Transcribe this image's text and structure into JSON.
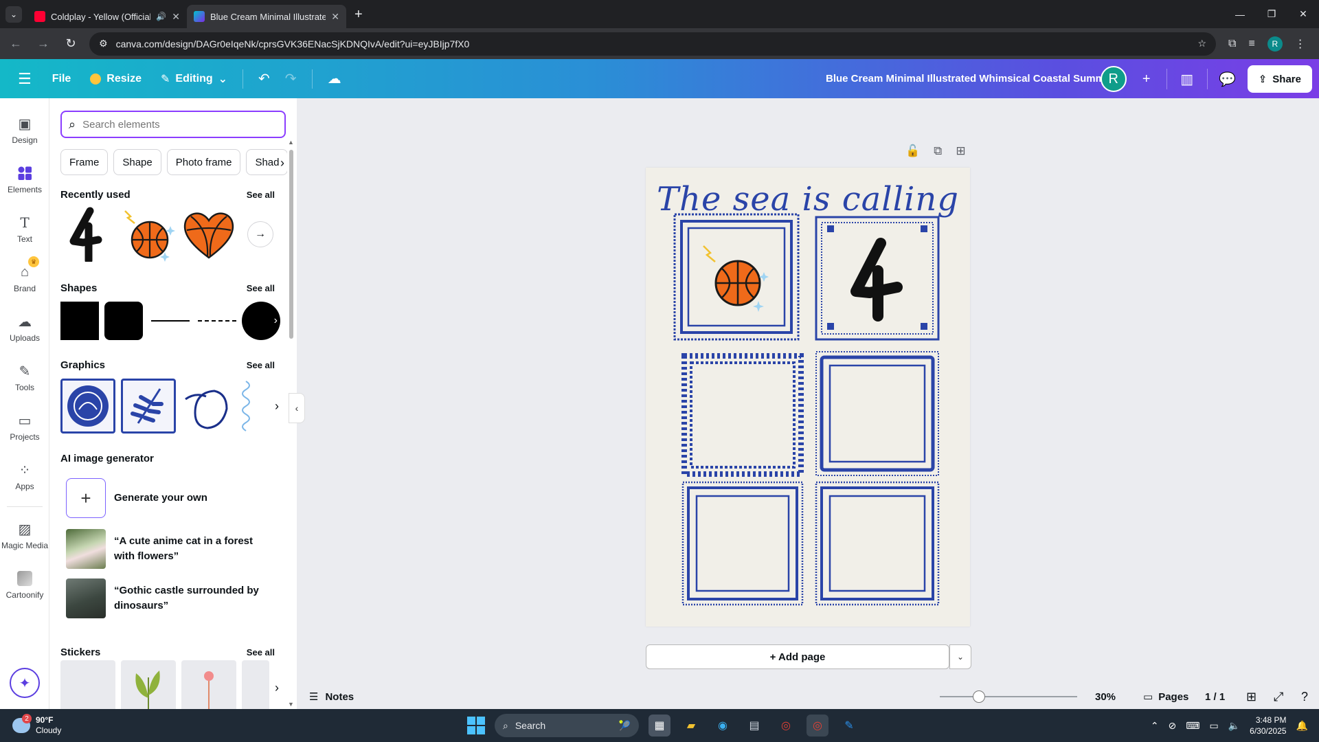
{
  "browser": {
    "tabs": [
      {
        "title": "Coldplay - Yellow (Official V",
        "active": false
      },
      {
        "title": "Blue Cream Minimal Illustrated",
        "active": true
      }
    ],
    "url": "canva.com/design/DAGr0eIqeNk/cprsGVK36ENacSjKDNQIvA/edit?ui=eyJBIjp7fX0"
  },
  "topbar": {
    "file_label": "File",
    "resize_label": "Resize",
    "editing_label": "Editing",
    "design_title": "Blue Cream Minimal Illustrated Whimsical Coastal Summer ...",
    "avatar_letter": "R",
    "share_label": "Share"
  },
  "rail": {
    "items": [
      {
        "label": "Design",
        "icon": "design-icon"
      },
      {
        "label": "Elements",
        "icon": "elements-icon"
      },
      {
        "label": "Text",
        "icon": "text-icon"
      },
      {
        "label": "Brand",
        "icon": "brand-icon"
      },
      {
        "label": "Uploads",
        "icon": "uploads-icon"
      },
      {
        "label": "Tools",
        "icon": "tools-icon"
      },
      {
        "label": "Projects",
        "icon": "projects-icon"
      },
      {
        "label": "Apps",
        "icon": "apps-icon"
      },
      {
        "label": "Magic Media",
        "icon": "magic-media-icon"
      },
      {
        "label": "Cartoonify",
        "icon": "cartoonify-icon"
      }
    ]
  },
  "panel": {
    "search_placeholder": "Search elements",
    "chips": [
      "Frame",
      "Shape",
      "Photo frame",
      "Shad"
    ],
    "recently_used": {
      "title": "Recently used",
      "see_all": "See all"
    },
    "shapes": {
      "title": "Shapes",
      "see_all": "See all"
    },
    "graphics": {
      "title": "Graphics",
      "see_all": "See all"
    },
    "ai": {
      "title": "AI image generator",
      "generate": "Generate your own",
      "prompts": [
        "“A cute anime cat in a forest with flowers”",
        "“Gothic castle surrounded by dinosaurs”"
      ]
    },
    "stickers": {
      "title": "Stickers",
      "see_all": "See all"
    }
  },
  "canvas": {
    "page_title": "The sea is calling",
    "add_page": "+ Add page"
  },
  "bottombar": {
    "notes": "Notes",
    "zoom": "30%",
    "zoom_level": 0.3,
    "pages": "Pages",
    "page_count": "1 / 1"
  },
  "taskbar": {
    "weather_temp": "90°F",
    "weather_desc": "Cloudy",
    "weather_badge": "2",
    "search": "Search",
    "time": "3:48 PM",
    "date": "6/30/2025"
  },
  "colors": {
    "accent": "#8b3dff",
    "frame_blue": "#2a44a8",
    "page_bg": "#f1efe8",
    "basketball": "#ef6a1a"
  }
}
